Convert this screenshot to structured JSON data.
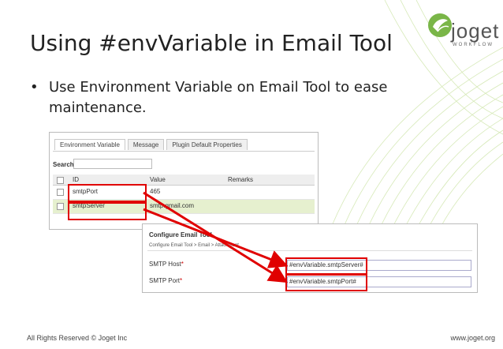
{
  "slide": {
    "title": "Using #envVariable in Email Tool",
    "bullet": "Use Environment Variable on Email Tool to ease maintenance."
  },
  "logo": {
    "word": "joget",
    "sub": "WORKFLOW"
  },
  "env_panel": {
    "tabs": [
      "Environment Variable",
      "Message",
      "Plugin Default Properties"
    ],
    "search_label": "Search",
    "search_value": "",
    "columns": [
      "ID",
      "Value",
      "Remarks"
    ],
    "rows": [
      {
        "id": "smtpPort",
        "value": "465",
        "remarks": ""
      },
      {
        "id": "smtpServer",
        "value": "smtp.gmail.com",
        "remarks": ""
      }
    ]
  },
  "email_tool": {
    "header": "Configure Email Tool",
    "breadcrumb": "Configure Email Tool > Email > Attachment",
    "fields": [
      {
        "label": "SMTP Host",
        "required": "*",
        "value": "#envVariable.smtpServer#"
      },
      {
        "label": "SMTP Port",
        "required": "*",
        "value": "#envVariable.smtpPort#"
      }
    ]
  },
  "footer": {
    "copyright": "All Rights Reserved © Joget Inc",
    "url": "www.joget.org"
  },
  "colors": {
    "highlight": "#e00000",
    "row_alt": "#e6f0cf",
    "brand_green": "#7ab648"
  }
}
